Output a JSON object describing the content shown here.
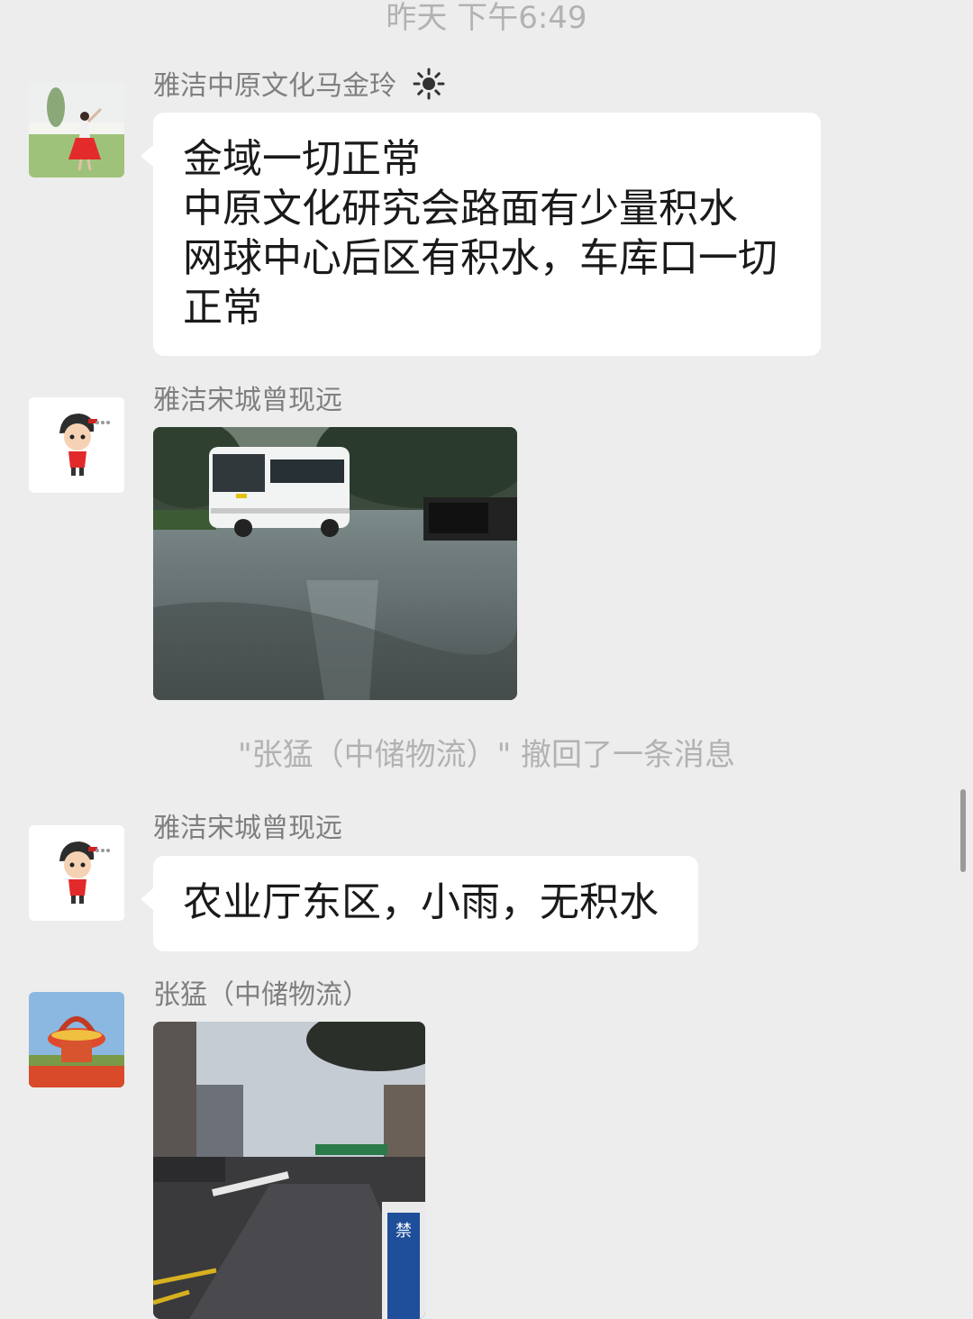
{
  "chat": {
    "timestamp": "昨天 下午6:49",
    "messages": [
      {
        "sender": "雅洁中原文化马金玲",
        "weather_icon": "sun-icon",
        "type": "text",
        "lines": [
          "金域一切正常",
          "中原文化研究会路面有少量积水",
          "网球中心后区有积水，车库口一切",
          "正常"
        ]
      },
      {
        "sender": "雅洁宋城曾现远",
        "type": "image",
        "image_desc_icon": "photo-icon"
      },
      {
        "sender": "雅洁宋城曾现远",
        "type": "text",
        "lines": [
          "农业厅东区，小雨，无积水"
        ]
      },
      {
        "sender": "张猛（中储物流）",
        "type": "image",
        "sign_text": "禁止未成年人"
      }
    ],
    "recall_notice": "\"张猛（中储物流）\" 撤回了一条消息"
  },
  "colors": {
    "background": "#ededed",
    "bubble": "#ffffff",
    "meta_text": "#b2b2b2",
    "sender_text": "#7f7f7f"
  }
}
